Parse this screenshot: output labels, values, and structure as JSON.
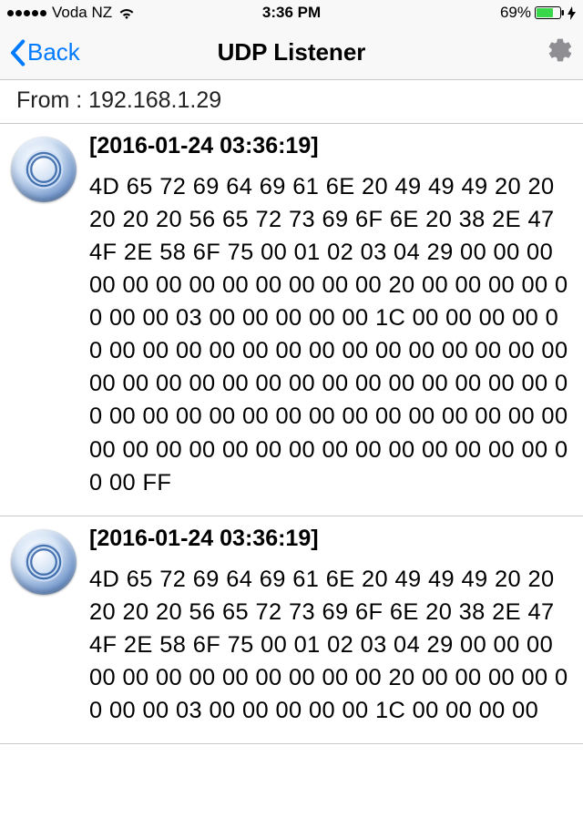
{
  "status": {
    "carrier": "Voda NZ",
    "time": "3:36 PM",
    "battery_pct": "69%"
  },
  "nav": {
    "back_label": "Back",
    "title": "UDP Listener"
  },
  "section": {
    "from_label": "From : 192.168.1.29"
  },
  "packets": [
    {
      "ts": "[2016-01-24 03:36:19]",
      "hex": "4D 65 72 69 64 69 61 6E 20 49 49 49 20 20 20 20 20 56 65 72 73 69 6F 6E 20 38 2E 47 4F 2E 58 6F 75 00 01 02 03 04 29 00 00 00 00 00 00 00 00 00 00 00 00 20 00 00 00 00 00 00 00 03 00 00 00 00 00 1C 00 00 00 00 00 00 00 00 00 00 00 00 00 00 00 00 00 00 00 00 00 00 00 00 00 00 00 00 00 00 00 00 00 00 00 00 00 00 00 00 00 00 00 00 00 00 00 00 00 00 00 00 00 00 00 00 00 00 00 00 00 00 00 00 FF"
    },
    {
      "ts": "[2016-01-24 03:36:19]",
      "hex": "4D 65 72 69 64 69 61 6E 20 49 49 49 20 20 20 20 20 56 65 72 73 69 6F 6E 20 38 2E 47 4F 2E 58 6F 75 00 01 02 03 04 29 00 00 00 00 00 00 00 00 00 00 00 00 20 00 00 00 00 00 00 00 03 00 00 00 00 00 1C 00 00 00 00"
    }
  ]
}
